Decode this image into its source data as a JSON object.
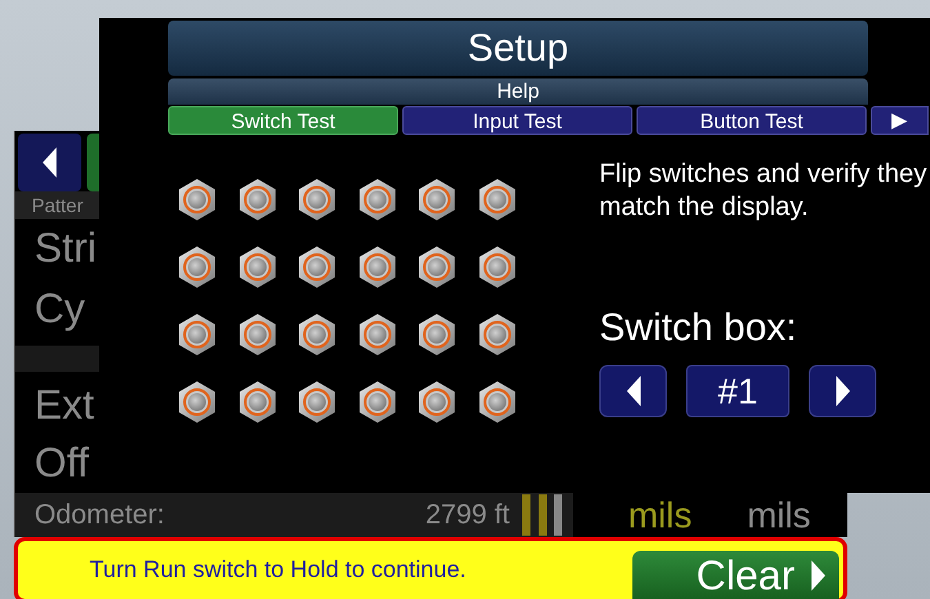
{
  "back_panel": {
    "header": "Patter",
    "rows": [
      "Stri",
      "Cy"
    ],
    "rows_lower": [
      "Ext",
      "Off"
    ],
    "odometer": {
      "label": "Odometer:",
      "value": "2799 ft"
    },
    "units": [
      {
        "text": "mils",
        "color": "#9a9a1e"
      },
      {
        "text": "mils",
        "color": "#8a8a8a"
      }
    ]
  },
  "dialog": {
    "title": "Setup",
    "help": "Help",
    "tabs": [
      {
        "label": "Switch Test",
        "selected": true
      },
      {
        "label": "Input Test",
        "selected": false
      },
      {
        "label": "Button Test",
        "selected": false
      }
    ],
    "more_tab": "▶",
    "instructions": "Flip switches and verify they match the display.",
    "switch_box": {
      "label": "Switch box:",
      "value": "#1"
    }
  },
  "message_bar": {
    "text": "Turn Run switch to Hold to continue.",
    "button": "Clear"
  }
}
